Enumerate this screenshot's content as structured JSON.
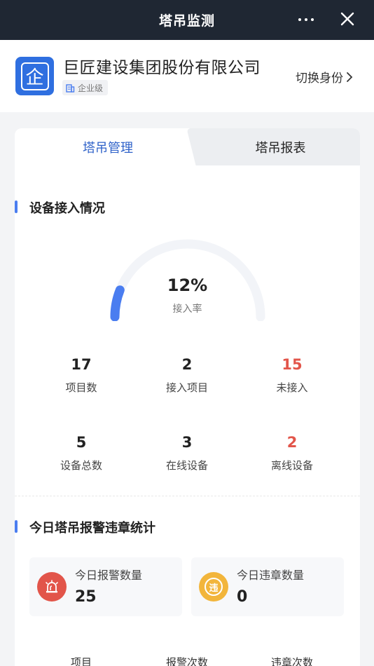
{
  "topbar": {
    "title": "塔吊监测"
  },
  "company": {
    "logo_char": "企",
    "name": "巨匠建设集团股份有限公司",
    "level": "企业级",
    "switch_label": "切换身份"
  },
  "tabs": [
    {
      "label": "塔吊管理"
    },
    {
      "label": "塔吊报表"
    }
  ],
  "access": {
    "title": "设备接入情况",
    "gauge": {
      "percent": 12,
      "value_text": "12%",
      "label": "接入率"
    },
    "stats": [
      {
        "value": "17",
        "label": "项目数"
      },
      {
        "value": "2",
        "label": "接入项目"
      },
      {
        "value": "15",
        "label": "未接入"
      },
      {
        "value": "5",
        "label": "设备总数"
      },
      {
        "value": "3",
        "label": "在线设备"
      },
      {
        "value": "2",
        "label": "离线设备"
      }
    ]
  },
  "today": {
    "title": "今日塔吊报警违章统计",
    "alarm": {
      "label": "今日报警数量",
      "value": "25"
    },
    "violation": {
      "label": "今日违章数量",
      "value": "0",
      "icon_char": "违"
    },
    "columns": [
      "项目",
      "报警次数",
      "违章次数"
    ]
  },
  "colors": {
    "accent": "#2f62c9",
    "gauge": "#4a7df0",
    "alarm": "#e2554a",
    "violation": "#f2b53b"
  }
}
